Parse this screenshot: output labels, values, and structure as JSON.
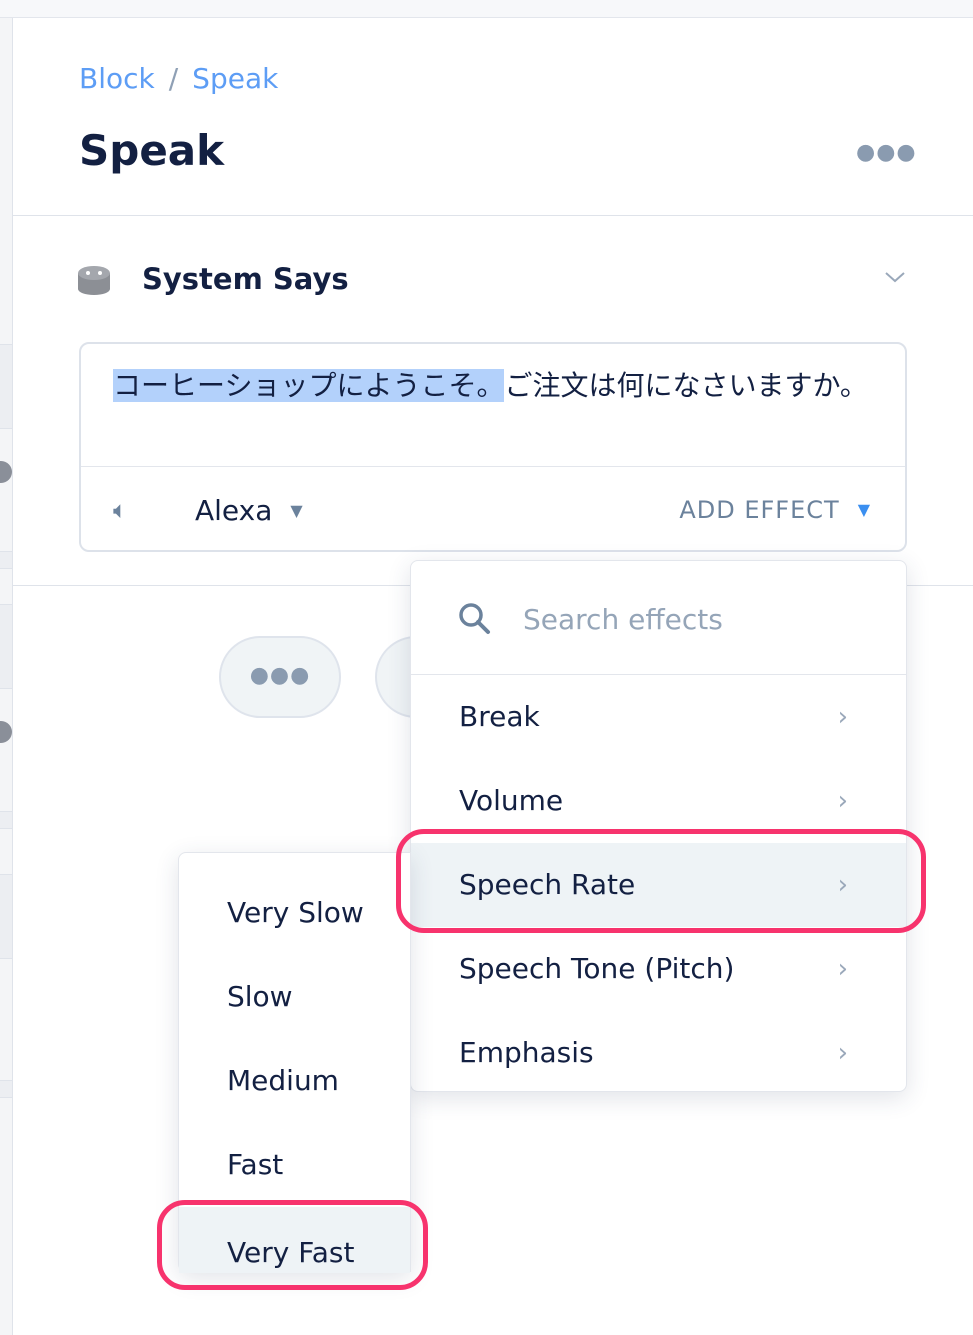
{
  "breadcrumb": {
    "items": [
      "Block",
      "Speak"
    ],
    "separator": "/"
  },
  "header": {
    "title": "Speak",
    "more_icon": "ellipsis-icon"
  },
  "section": {
    "title": "System Says",
    "icon": "echo-device-icon",
    "collapse_icon": "chevron-down-icon"
  },
  "prompt": {
    "selected_text": "コーヒーショップにようこそ。",
    "rest_text": "ご注文は何になさいますか。",
    "voice": "Alexa",
    "add_effect": "ADD EFFECT"
  },
  "effects_menu": {
    "search_placeholder": "Search effects",
    "items": [
      {
        "label": "Break"
      },
      {
        "label": "Volume"
      },
      {
        "label": "Speech Rate",
        "highlighted": true
      },
      {
        "label": "Speech Tone (Pitch)"
      },
      {
        "label": "Emphasis"
      }
    ]
  },
  "speech_rate_menu": {
    "items": [
      {
        "label": "Very Slow"
      },
      {
        "label": "Slow"
      },
      {
        "label": "Medium"
      },
      {
        "label": "Fast"
      },
      {
        "label": "Very Fast",
        "highlighted": true
      }
    ]
  },
  "colors": {
    "link": "#5d9df5",
    "highlight_ring": "#f7336d",
    "selection": "#b3d1fb",
    "text": "#132042"
  }
}
